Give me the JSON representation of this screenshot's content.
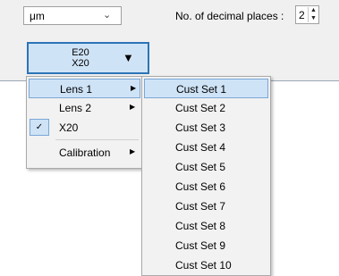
{
  "toolbar": {
    "unit_value": "μm",
    "decimal_label": "No. of decimal places :",
    "decimal_value": "2"
  },
  "lens_button": {
    "line1": "E20",
    "line2": "X20",
    "arrow": "▼"
  },
  "lens_menu": {
    "items": [
      {
        "label": "Lens 1",
        "has_submenu": true,
        "highlighted": true
      },
      {
        "label": "Lens 2",
        "has_submenu": true
      },
      {
        "label": "X20",
        "checked": true
      },
      {
        "label": "Calibration",
        "has_submenu": true
      }
    ]
  },
  "cust_set_menu": {
    "items": [
      "Cust Set 1",
      "Cust Set 2",
      "Cust Set 3",
      "Cust Set 4",
      "Cust Set 5",
      "Cust Set 6",
      "Cust Set 7",
      "Cust Set 8",
      "Cust Set 9",
      "Cust Set 10"
    ],
    "highlighted_index": 0
  },
  "icons": {
    "chevron": "⌄",
    "submenu_arrow": "▶",
    "check": "✓",
    "spin_up": "▲",
    "spin_down": "▼"
  }
}
